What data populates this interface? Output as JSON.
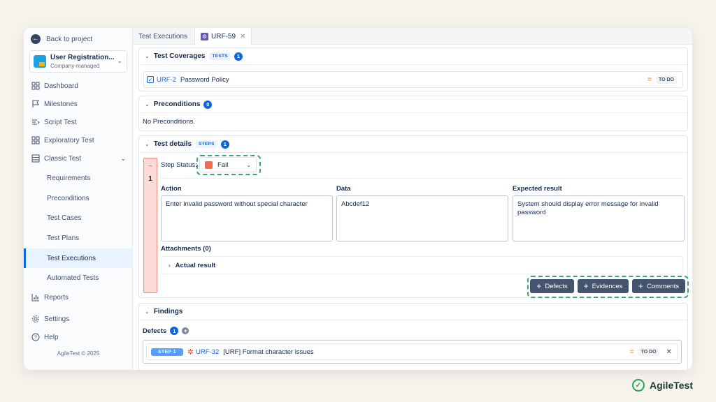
{
  "sidebar": {
    "back_label": "Back to project",
    "project": {
      "name": "User Registration...",
      "type": "Company-managed"
    },
    "items": [
      {
        "label": "Dashboard",
        "icon": "grid-icon"
      },
      {
        "label": "Milestones",
        "icon": "flag-icon"
      },
      {
        "label": "Script Test",
        "icon": "script-icon"
      },
      {
        "label": "Exploratory Test",
        "icon": "grid-icon"
      },
      {
        "label": "Classic Test",
        "icon": "table-icon"
      }
    ],
    "sub_items": [
      "Requirements",
      "Preconditions",
      "Test Cases",
      "Test Plans",
      "Test Executions",
      "Automated Tests"
    ],
    "bottom_items": [
      {
        "label": "Reports",
        "icon": "chart-icon"
      },
      {
        "label": "Settings",
        "icon": "gear-icon"
      },
      {
        "label": "Help",
        "icon": "help-icon"
      }
    ],
    "copyright": "AgileTest © 2025"
  },
  "tabs": {
    "executions": "Test Executions",
    "current": "URF-59"
  },
  "coverages": {
    "title": "Test Coverages",
    "tag": "TESTS",
    "count": "1",
    "item": {
      "key": "URF-2",
      "title": "Password Policy",
      "status": "TO DO"
    }
  },
  "preconditions": {
    "title": "Preconditions",
    "count": "0",
    "empty_text": "No Preconditions."
  },
  "test_details": {
    "title": "Test details",
    "tag": "STEPS",
    "count": "1",
    "step_dash": "–",
    "step_number": "1",
    "status_label": "Step Status:",
    "status_value": "Fail",
    "action_label": "Action",
    "action_value": "Enter invalid password without special character",
    "data_label": "Data",
    "data_value": "Abcdef12",
    "expected_label": "Expected result",
    "expected_value": "System should display error message for invalid password",
    "attachments": "Attachments (0)",
    "actual_result": "Actual result",
    "buttons": {
      "defects": "Defects",
      "evidences": "Evidences",
      "comments": "Comments"
    }
  },
  "findings": {
    "title": "Findings",
    "defects_label": "Defects",
    "defects_count": "1",
    "defect": {
      "step": "STEP 1",
      "key": "URF-32",
      "title": "[URF] Format character issues",
      "status": "TO DO"
    }
  },
  "brand": "AgileTest"
}
